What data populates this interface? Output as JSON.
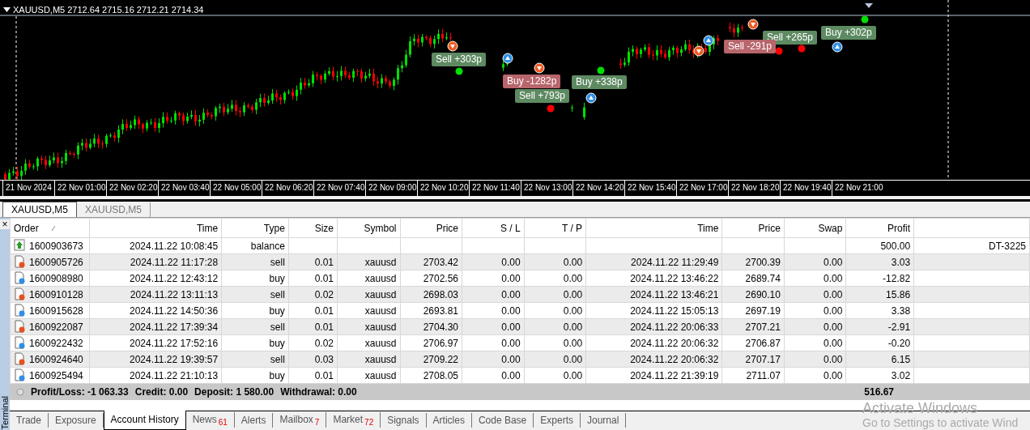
{
  "chart": {
    "header": "XAUUSD,M5",
    "ohlc": "2712.64 2715.16 2712.21 2714.34",
    "trade_labels": [
      {
        "text": "Sell +303p",
        "kind": "profit"
      },
      {
        "text": "Sell +793p",
        "kind": "profit"
      },
      {
        "text": "Buy -1282p",
        "kind": "loss"
      },
      {
        "text": "Buy +338p",
        "kind": "profit"
      },
      {
        "text": "Sell +265p",
        "kind": "profit"
      },
      {
        "text": "Sell -291p",
        "kind": "loss"
      },
      {
        "text": "Buy +302p",
        "kind": "profit"
      }
    ],
    "time_axis": [
      "21 Nov 2024",
      "22 Nov 01:00",
      "22 Nov 02:20",
      "22 Nov 03:40",
      "22 Nov 05:00",
      "22 Nov 06:20",
      "22 Nov 07:40",
      "22 Nov 09:00",
      "22 Nov 10:20",
      "22 Nov 11:40",
      "22 Nov 13:00",
      "22 Nov 14:20",
      "22 Nov 15:40",
      "22 Nov 17:00",
      "22 Nov 18:20",
      "22 Nov 19:40",
      "22 Nov 21:00"
    ]
  },
  "chart_tabs": [
    {
      "label": "XAUUSD,M5",
      "selected": true
    },
    {
      "label": "XAUUSD,M5",
      "selected": false
    }
  ],
  "terminal": {
    "close": "×",
    "side_label": "Terminal",
    "columns": [
      "Order",
      "Time",
      "Type",
      "Size",
      "Symbol",
      "Price",
      "S / L",
      "T / P",
      "Time",
      "Price",
      "Swap",
      "Profit"
    ],
    "rows": [
      {
        "kind": "balance",
        "cells": [
          "1600903673",
          "2024.11.22 10:08:45",
          "balance",
          "",
          "",
          "",
          "",
          "",
          "",
          "",
          "",
          "500.00",
          "DT-3225"
        ]
      },
      {
        "kind": "sell",
        "cells": [
          "1600905726",
          "2024.11.22 11:17:28",
          "sell",
          "0.01",
          "xauusd",
          "2703.42",
          "0.00",
          "0.00",
          "2024.11.22 11:29:49",
          "2700.39",
          "0.00",
          "3.03",
          ""
        ]
      },
      {
        "kind": "buy",
        "cells": [
          "1600908980",
          "2024.11.22 12:43:12",
          "buy",
          "0.01",
          "xauusd",
          "2702.56",
          "0.00",
          "0.00",
          "2024.11.22 13:46:22",
          "2689.74",
          "0.00",
          "-12.82",
          ""
        ]
      },
      {
        "kind": "sell",
        "cells": [
          "1600910128",
          "2024.11.22 13:11:13",
          "sell",
          "0.02",
          "xauusd",
          "2698.03",
          "0.00",
          "0.00",
          "2024.11.22 13:46:21",
          "2690.10",
          "0.00",
          "15.86",
          ""
        ]
      },
      {
        "kind": "buy",
        "cells": [
          "1600915628",
          "2024.11.22 14:50:36",
          "buy",
          "0.01",
          "xauusd",
          "2693.81",
          "0.00",
          "0.00",
          "2024.11.22 15:05:13",
          "2697.19",
          "0.00",
          "3.38",
          ""
        ]
      },
      {
        "kind": "sell",
        "cells": [
          "1600922087",
          "2024.11.22 17:39:34",
          "sell",
          "0.01",
          "xauusd",
          "2704.30",
          "0.00",
          "0.00",
          "2024.11.22 20:06:33",
          "2707.21",
          "0.00",
          "-2.91",
          ""
        ]
      },
      {
        "kind": "buy",
        "cells": [
          "1600922432",
          "2024.11.22 17:52:16",
          "buy",
          "0.02",
          "xauusd",
          "2706.97",
          "0.00",
          "0.00",
          "2024.11.22 20:06:32",
          "2706.87",
          "0.00",
          "-0.20",
          ""
        ]
      },
      {
        "kind": "sell",
        "cells": [
          "1600924640",
          "2024.11.22 19:39:57",
          "sell",
          "0.03",
          "xauusd",
          "2709.22",
          "0.00",
          "0.00",
          "2024.11.22 20:06:32",
          "2707.17",
          "0.00",
          "6.15",
          ""
        ]
      },
      {
        "kind": "buy",
        "cells": [
          "1600925494",
          "2024.11.22 21:10:13",
          "buy",
          "0.01",
          "xauusd",
          "2708.05",
          "0.00",
          "0.00",
          "2024.11.22 21:39:19",
          "2711.07",
          "0.00",
          "3.02",
          ""
        ]
      }
    ],
    "summary": [
      "Profit/Loss: -1 063.33",
      "Credit: 0.00",
      "Deposit: 1 580.00",
      "Withdrawal: 0.00"
    ],
    "total": "516.67",
    "tabs": [
      {
        "label": "Trade",
        "selected": false
      },
      {
        "label": "Exposure",
        "selected": false
      },
      {
        "label": "Account History",
        "selected": true
      },
      {
        "label": "News",
        "count": "61",
        "selected": false
      },
      {
        "label": "Alerts",
        "selected": false
      },
      {
        "label": "Mailbox",
        "count": "7",
        "selected": false
      },
      {
        "label": "Market",
        "count": "72",
        "selected": false
      },
      {
        "label": "Signals",
        "selected": false
      },
      {
        "label": "Articles",
        "selected": false
      },
      {
        "label": "Code Base",
        "selected": false
      },
      {
        "label": "Experts",
        "selected": false
      },
      {
        "label": "Journal",
        "selected": false
      }
    ]
  },
  "activation_notice": {
    "title": "Activate Windows",
    "message": "Go to Settings to activate Wind"
  }
}
